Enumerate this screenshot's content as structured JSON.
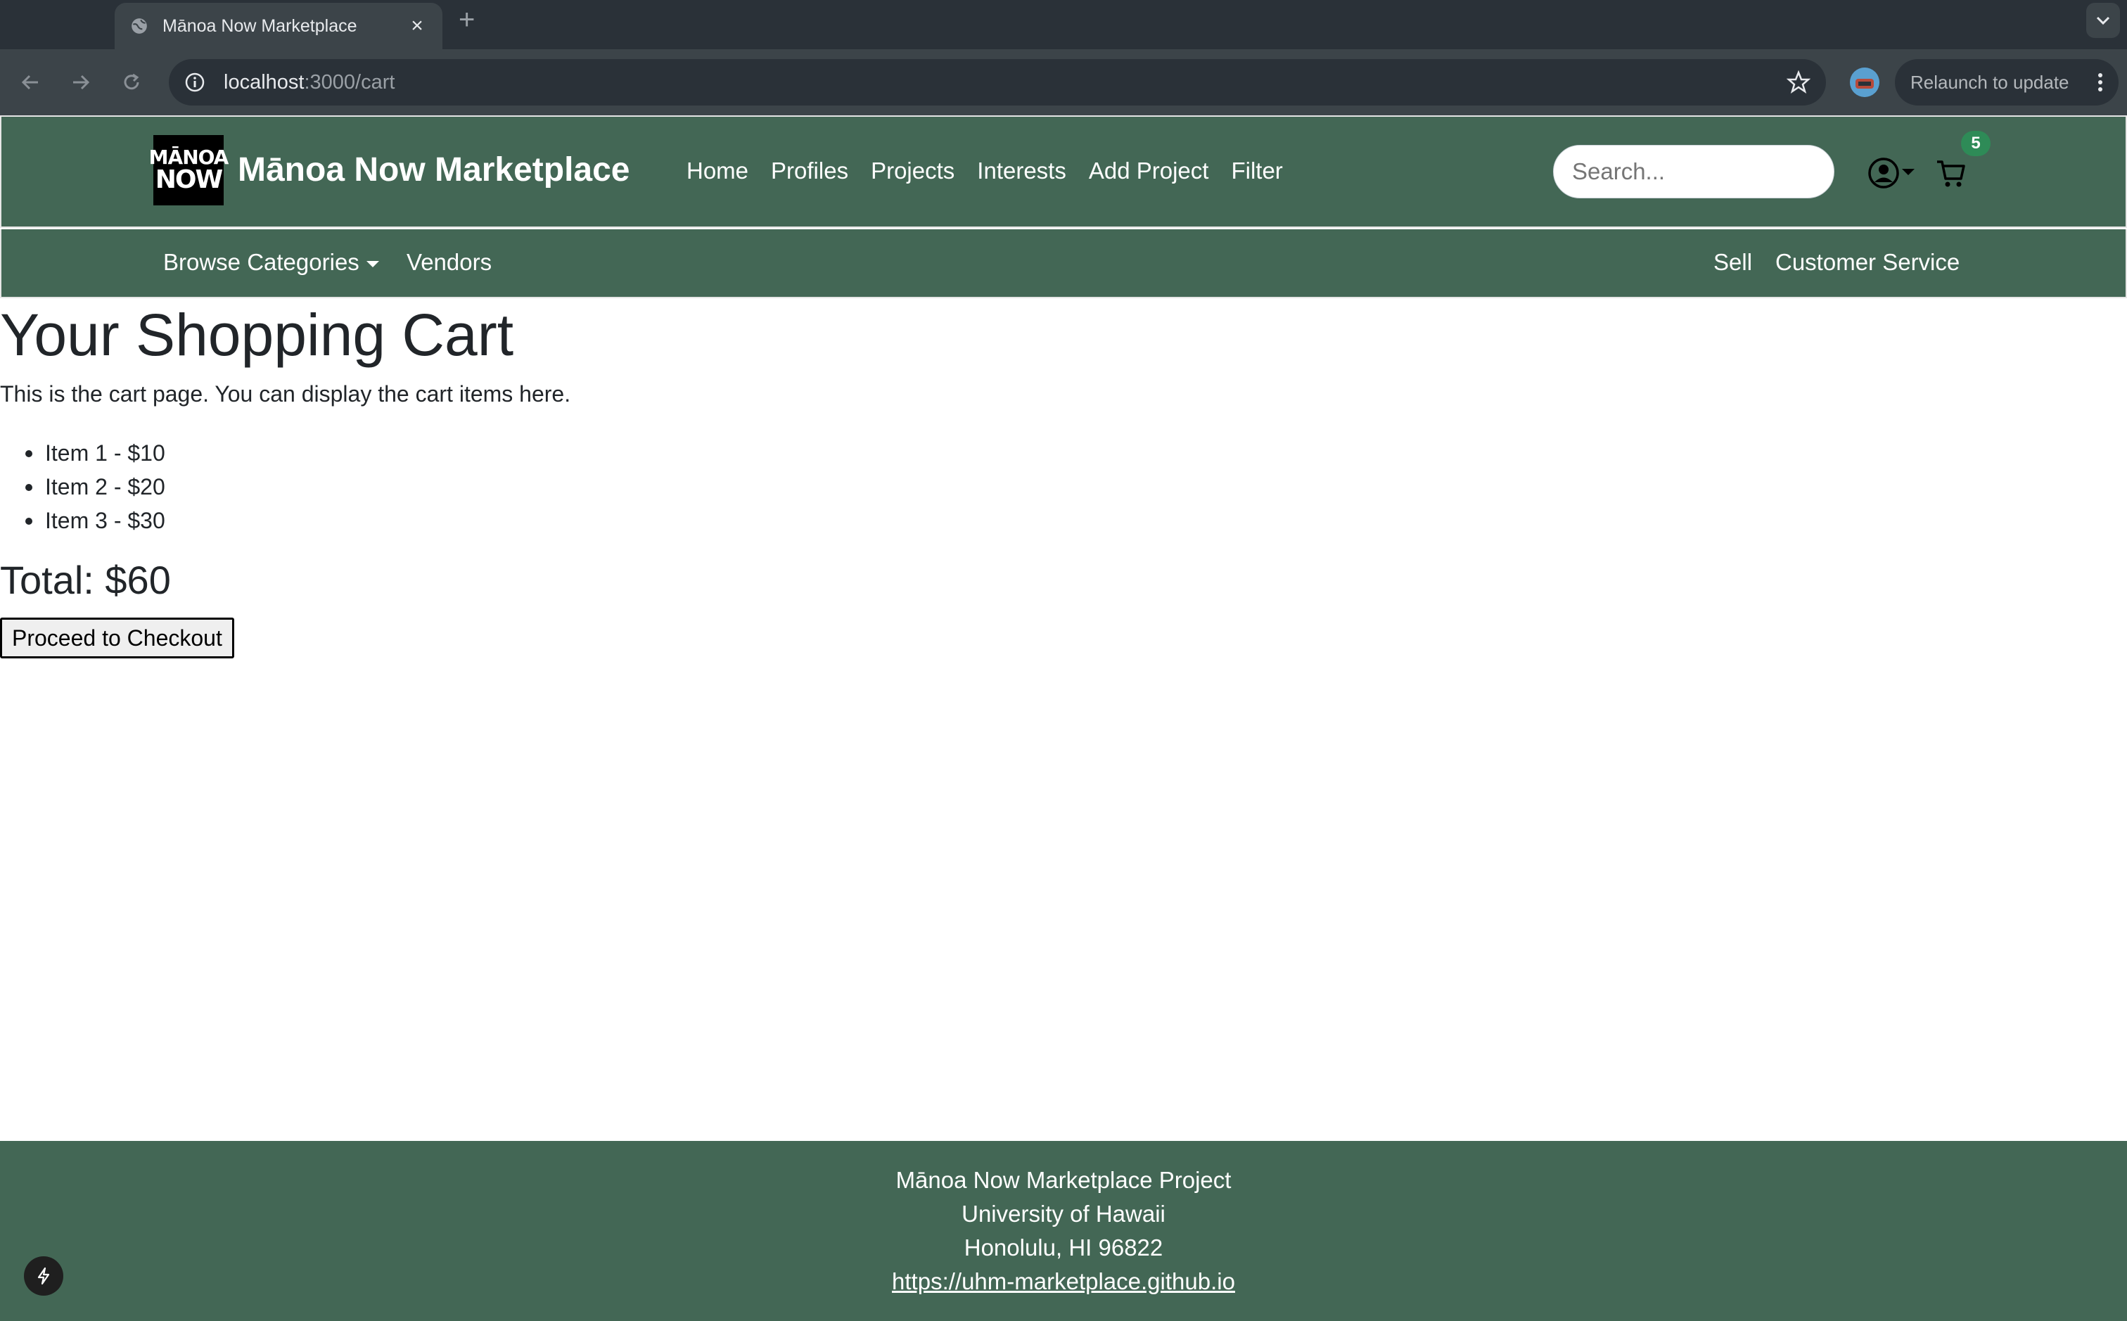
{
  "browser": {
    "tab_title": "Mānoa Now Marketplace",
    "url_host": "localhost",
    "url_path": ":3000/cart",
    "relaunch_label": "Relaunch to update"
  },
  "site": {
    "logo_line1": "MĀNOA",
    "logo_line2": "NOW",
    "brand": "Mānoa Now Marketplace",
    "nav": {
      "home": "Home",
      "profiles": "Profiles",
      "projects": "Projects",
      "interests": "Interests",
      "add_project": "Add Project",
      "filter": "Filter"
    },
    "search_placeholder": "Search...",
    "cart_count": "5",
    "subnav": {
      "browse": "Browse Categories",
      "vendors": "Vendors",
      "sell": "Sell",
      "customer_service": "Customer Service"
    }
  },
  "cart": {
    "title": "Your Shopping Cart",
    "intro": "This is the cart page. You can display the cart items here.",
    "items": [
      "Item 1 - $10",
      "Item 2 - $20",
      "Item 3 - $30"
    ],
    "total": "Total: $60",
    "checkout_label": "Proceed to Checkout"
  },
  "footer": {
    "line1": "Mānoa Now Marketplace Project",
    "line2": "University of Hawaii",
    "line3": "Honolulu, HI 96822",
    "link": "https://uhm-marketplace.github.io"
  },
  "colors": {
    "nav_green": "#436755",
    "badge_green": "#2e8b57",
    "chrome_dark": "#2a3138"
  }
}
